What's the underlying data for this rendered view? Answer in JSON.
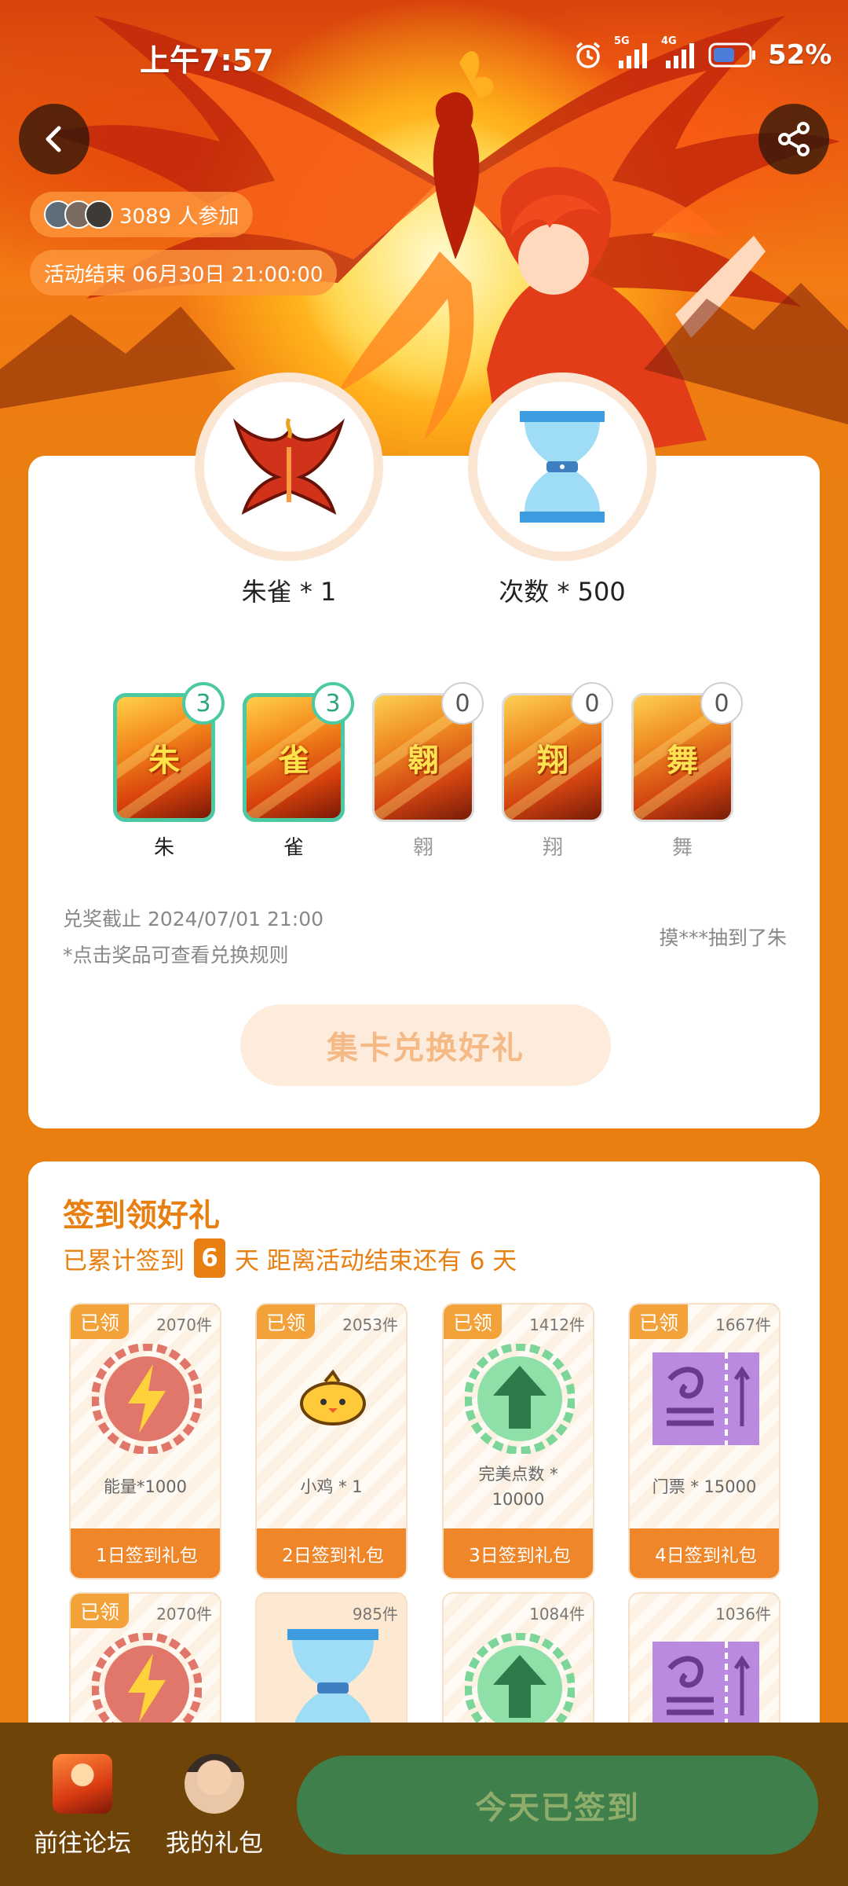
{
  "status_bar": {
    "time": "上午7:57",
    "signal1_label": "5G",
    "signal2_label": "4G",
    "battery": "52%"
  },
  "header": {
    "back_icon": "chevron-left-icon",
    "share_icon": "share-icon",
    "participants": "3089 人参加",
    "end_time": "活动结束 06月30日 21:00:00"
  },
  "rewards": {
    "phoenix_label": "朱雀 * 1",
    "attempts_label": "次数 * 500"
  },
  "collect_cards": [
    {
      "char": "朱",
      "count": "3",
      "owned": true
    },
    {
      "char": "雀",
      "count": "3",
      "owned": true
    },
    {
      "char": "翱",
      "count": "0",
      "owned": false
    },
    {
      "char": "翔",
      "count": "0",
      "owned": false
    },
    {
      "char": "舞",
      "count": "0",
      "owned": false
    }
  ],
  "redeem": {
    "deadline": "兑奖截止 2024/07/01 21:00",
    "note": "*点击奖品可查看兑换规则",
    "winner": "摸***抽到了朱",
    "button": "集卡兑换好礼"
  },
  "checkin": {
    "title": "签到领好礼",
    "sub_prefix": "已累计签到",
    "days": "6",
    "sub_suffix": "天  距离活动结束还有 6 天",
    "gifts": [
      {
        "tag": "已领",
        "count": "2070件",
        "label": "能量*1000",
        "label2": "",
        "foot": "1日签到礼包",
        "icon": "lightning-icon"
      },
      {
        "tag": "已领",
        "count": "2053件",
        "label": "小鸡 * 1",
        "label2": "",
        "foot": "2日签到礼包",
        "icon": "chick-icon"
      },
      {
        "tag": "已领",
        "count": "1412件",
        "label": "完美点数 *",
        "label2": "10000",
        "foot": "3日签到礼包",
        "icon": "up-arrow-icon"
      },
      {
        "tag": "已领",
        "count": "1667件",
        "label": "门票 * 15000",
        "label2": "",
        "foot": "4日签到礼包",
        "icon": "ticket-icon"
      },
      {
        "tag": "已领",
        "count": "2070件",
        "icon": "lightning-icon"
      },
      {
        "tag": "",
        "count": "985件",
        "icon": "hourglass-icon"
      },
      {
        "tag": "",
        "count": "1084件",
        "icon": "up-arrow-icon"
      },
      {
        "tag": "",
        "count": "1036件",
        "icon": "ticket-icon"
      }
    ]
  },
  "bottom_bar": {
    "forum": "前往论坛",
    "my_gifts": "我的礼包",
    "checked_in": "今天已签到"
  },
  "colors": {
    "accent": "#e87f10",
    "owned_border": "#4bc9a3",
    "checked_button": "#3f7f4c",
    "bottom_bar": "#6e4409"
  }
}
